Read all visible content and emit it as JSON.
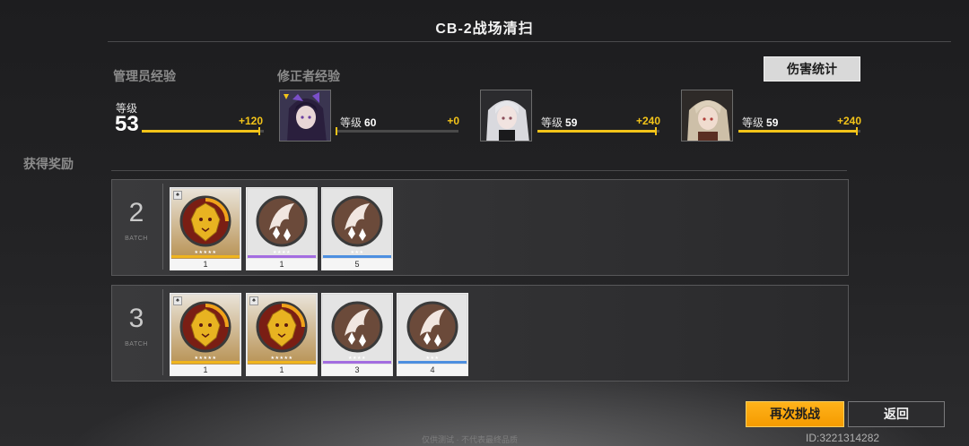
{
  "title": "CB-2战场清扫",
  "damage_stats_label": "伤害统计",
  "admin_exp": {
    "heading": "管理员经验",
    "level_label": "等级",
    "level": "53",
    "gain": "+120",
    "progress": 0.97
  },
  "modifier_exp": {
    "heading": "修正者经验",
    "characters": [
      {
        "level_label": "等级",
        "level": "60",
        "gain": "+0",
        "progress": 0.0
      },
      {
        "level_label": "等级",
        "level": "59",
        "gain": "+240",
        "progress": 0.98
      },
      {
        "level_label": "等级",
        "level": "59",
        "gain": "+240",
        "progress": 0.98
      }
    ]
  },
  "rewards_heading": "获得奖励",
  "batch_word": "BATCH",
  "batches": [
    {
      "number": "2",
      "items": [
        {
          "kind": "gold-lion",
          "stars": "★★★★★",
          "count": "1",
          "rarity_color": "#f0b51d"
        },
        {
          "kind": "feather",
          "stars": "★★★★",
          "count": "1",
          "rarity_color": "#a36de0"
        },
        {
          "kind": "feather",
          "stars": "★★★",
          "count": "5",
          "rarity_color": "#4d8fe0"
        }
      ]
    },
    {
      "number": "3",
      "items": [
        {
          "kind": "gold-lion",
          "stars": "★★★★★",
          "count": "1",
          "rarity_color": "#f0b51d"
        },
        {
          "kind": "gold-lion",
          "stars": "★★★★★",
          "count": "1",
          "rarity_color": "#f0b51d"
        },
        {
          "kind": "feather",
          "stars": "★★★★",
          "count": "3",
          "rarity_color": "#a36de0"
        },
        {
          "kind": "feather",
          "stars": "★★★",
          "count": "4",
          "rarity_color": "#4d8fe0"
        }
      ]
    }
  ],
  "buttons": {
    "again": "再次挑战",
    "back": "返回"
  },
  "uid": "ID:3221314282",
  "bottom_note": "仅供测试 · 不代表最终品质",
  "colors": {
    "accent": "#f3c419",
    "again_button": "#f59b00"
  }
}
